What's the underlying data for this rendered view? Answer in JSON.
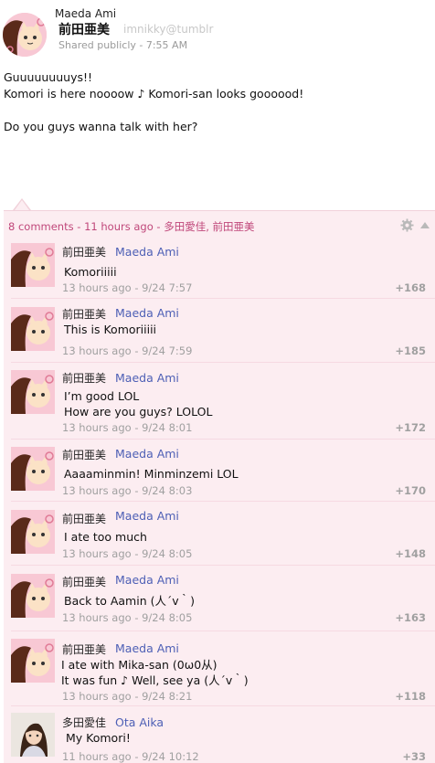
{
  "post": {
    "author_en": "Maeda Ami",
    "author_jp": "前田亜美",
    "handle": "imnikky@tumblr",
    "meta": "Shared publicly  -  7:55 AM",
    "lines": [
      "Guuuuuuuuys!!",
      "Komori is here noooow ♪ Komori-san looks goooood!",
      "",
      "Do you guys wanna talk with her?"
    ]
  },
  "comments_summary": {
    "count": "8 comments",
    "time": "11 hours ago",
    "participants": "多田愛佳, 前田亜美"
  },
  "comments": [
    {
      "name_jp": "前田亜美",
      "name_en": "Maeda Ami",
      "lines": [
        "Komoriiiii"
      ],
      "time": "13 hours ago - 9/24 7:57",
      "plus": "+168",
      "avatar": "ami-cat-avatar"
    },
    {
      "name_jp": "前田亜美",
      "name_en": "Maeda Ami",
      "lines": [
        "This is Komoriiiii"
      ],
      "time": "13 hours ago - 9/24 7:59",
      "plus": "+185",
      "avatar": "ami-cat-avatar"
    },
    {
      "name_jp": "前田亜美",
      "name_en": "Maeda Ami",
      "lines": [
        "I’m good LOL",
        "How are you guys? LOLOL"
      ],
      "time": "13 hours ago - 9/24 8:01",
      "plus": "+172",
      "avatar": "ami-cat-avatar"
    },
    {
      "name_jp": "前田亜美",
      "name_en": "Maeda Ami",
      "lines": [
        "Aaaaminmin! Minminzemi LOL"
      ],
      "time": "13 hours ago - 9/24 8:03",
      "plus": "+170",
      "avatar": "ami-cat-avatar"
    },
    {
      "name_jp": "前田亜美",
      "name_en": "Maeda Ami",
      "lines": [
        "I ate too much"
      ],
      "time": "13 hours ago - 9/24 8:05",
      "plus": "+148",
      "avatar": "ami-cat-avatar"
    },
    {
      "name_jp": "前田亜美",
      "name_en": "Maeda Ami",
      "lines": [
        "Back to Aamin (人´v｀)"
      ],
      "time": "13 hours ago - 9/24 8:05",
      "plus": "+163",
      "avatar": "ami-cat-avatar"
    },
    {
      "name_jp": "前田亜美",
      "name_en": "Maeda Ami",
      "lines": [
        "I ate with Mika-san (0ω0从)",
        "It was fun ♪ Well, see ya (人´v｀)"
      ],
      "time": "13 hours ago - 9/24 8:21",
      "plus": "+118",
      "avatar": "ami-cat-avatar"
    },
    {
      "name_jp": "多田愛佳",
      "name_en": "Ota Aika",
      "lines": [
        "My Komori!"
      ],
      "time": "11 hours ago - 9/24 10:12",
      "plus": "+33",
      "avatar": "aika-photo-avatar"
    }
  ]
}
